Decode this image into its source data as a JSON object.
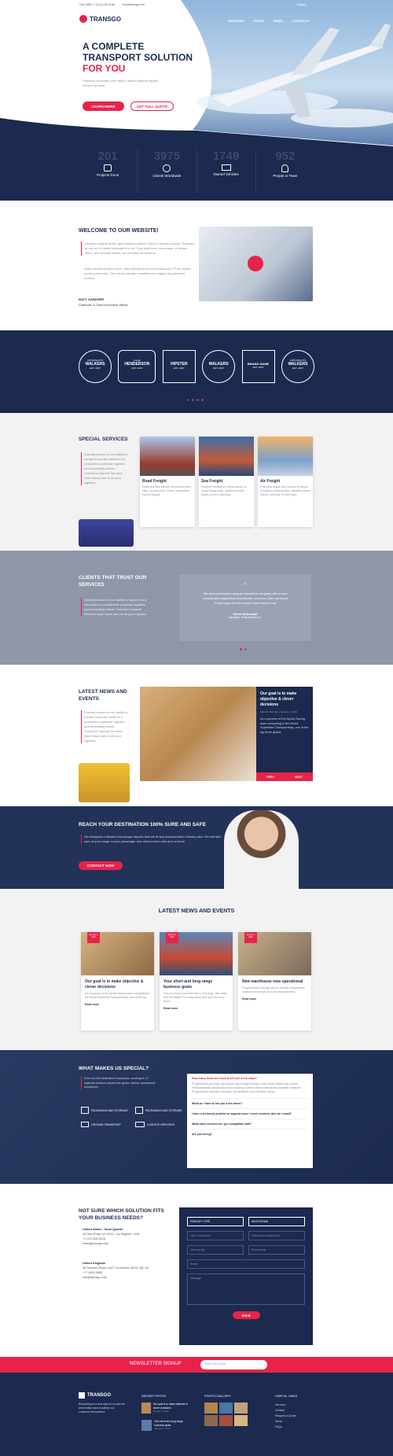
{
  "topbar": {
    "phone": "Call 1988 • 1 (212) 234 4138",
    "email": "info@transgo.com",
    "language": "English"
  },
  "brand": {
    "name": "TRANSGO"
  },
  "nav": [
    "SERVICES",
    "PAGES",
    "NEWS",
    "CONTACTS"
  ],
  "hero": {
    "line1": "A COMPLETE",
    "line2": "TRANSPORT SOLUTION",
    "line3": "FOR YOU",
    "text": "Praesent venenatis velit neque, aliquet semper sapien semper sit amet.",
    "btn_more": "LEARN MORE",
    "btn_quote": "GET FULL QUOTE"
  },
  "stats": [
    {
      "num": "201",
      "label": "Projects Done"
    },
    {
      "num": "3975",
      "label": "Clients Worldwide"
    },
    {
      "num": "1749",
      "label": "Owned Vehicles"
    },
    {
      "num": "952",
      "label": "People in Team"
    }
  ],
  "welcome": {
    "title": "WELCOME TO OUR WEBSITE!",
    "p1": "Aenean volutpat tortor eget euismod laoreet. Nunc in faucibus ipsum. Praesent at orci ac mi mattis vehicula et ut mi. Cras eget nunc accumsan, ut dictum libero, per conubia nostra, per inceptos himenaeos.",
    "p2": "Etiam lobortis tempor dolor, vitae bibendum lorem faucibus sed. Proin lacinia purus porta tortor. Orci varius natoque penatibus et magnis dis parturient montes.",
    "name": "MATT GARDNER",
    "role": "Chairman & Chief Executive Officer"
  },
  "logos": [
    {
      "top": "ASTRONAUTS",
      "main": "WALKERS",
      "sub": "EST. 2007"
    },
    {
      "top": "Joseph",
      "main": "HENDERSON",
      "sub": "EST. 2007"
    },
    {
      "top": "",
      "main": "HIPSTER",
      "sub": "EST. 2007"
    },
    {
      "top": "",
      "main": "WALKERS",
      "sub": "EST. 2007"
    },
    {
      "top": "",
      "main": "BRAND NAME",
      "sub": "EST. 2007"
    },
    {
      "top": "ASTRONAUTS",
      "main": "WALKERS",
      "sub": "EST. 2007"
    }
  ],
  "services": {
    "title": "SPECIAL SERVICES",
    "text": "Globally known for our ability to handle every last detail of our customers' particular logistics and forwarding needs, TransGo's Special Services team takes care of all your logistics.",
    "items": [
      {
        "title": "Road Freight",
        "text": "Morbi sed odio blandit, elementum dolor vitae, cursus turpis. Donec consectetur viverra feugiat."
      },
      {
        "title": "Sea Freight",
        "text": "Vivamus vestibulum luctus mauris, id ornare ligula nulla. Vestibulum ante ipsum primis in faucibus."
      },
      {
        "title": "Air Freight",
        "text": "Phasellus augue elit, rhoncus et dictum a, eleifend placerat diam. Aliquam massa mauris, vehicula vel felis eget."
      }
    ]
  },
  "clients": {
    "title": "CLIENTS THAT TRUST OUR SERVICES",
    "text": "Globally known for our ability to handle every last detail of a customers' particular logistics and forwarding needs, TransGo's Special Services team takes care of all your logistics.",
    "quote": "We were previously using an unreliable company with a very complicated registration and transfer process. Then we found TransCargo and the control came back to us.",
    "person": "Steve McDonald",
    "company": "Manager, Tesla Motors Inc."
  },
  "news": {
    "title": "LATEST NEWS AND EVENTS",
    "text": "Globally known for our ability to handle every last detail of a customers' particular logistics and forwarding needs, TransGo's Special Services team takes care of all your logistics.",
    "post_title": "Our goal is to make objective & clever decisions",
    "post_meta": "Malcolm Balmain • January 3, 2016",
    "post_text": "As a sponsor of the Apollo Racing team competing in the World Superbike Championship, one of the top three global.",
    "prev": "PREV",
    "next": "NEXT"
  },
  "cta": {
    "title": "REACH YOUR DESTINATION 100% SURE AND SAFE",
    "text": "We designed a detailed homepage layouts that will fit any transportation industry also. We will take care of your cargo or your passenger and deliver them safe and on time!",
    "btn": "CONTACT NOW"
  },
  "news2": {
    "title": "LATEST NEWS AND EVENTS",
    "read": "Read more",
    "items": [
      {
        "date": "January 3, 2016",
        "title": "Our goal is to make objective & clever decisions",
        "text": "As a sponsor of the Apollo Racing team competing in the World Superbike Championship, one of the top."
      },
      {
        "date": "January 3, 2016",
        "title": "Your short and long range business goals",
        "text": "How to move a machine that is 20m long, 18m wide and 4m height? It is easy when you have the best team."
      },
      {
        "date": "January 3, 2016",
        "title": "New warehouse now operational",
        "text": "Progressively leverage other's domain-independent business wholesale vis-a-vis empowerment."
      }
    ]
  },
  "special": {
    "title": "WHAT MAKES US SPECIAL?",
    "text": "Over 40,000 dedicated employees, working in 17 regional clusters around the globe, deliver operational excellence.",
    "features": [
      "PACKAGING AND STORAGE",
      "PACKAGING AND STORAGE",
      "GROUND TRANSPORT",
      "LOGISTIC SERVICES"
    ],
    "faq": [
      {
        "q": "How many times do I have to tell you a few ways?",
        "a": "Progressively generate synergistic total linkage through cross-media intellectual capital. Enthusiastically parallel task team building e-tailers without standards compliant initiatives. Progressively maintain extensive infomediaries via extensible niches."
      },
      {
        "q": "What do I have to tell you a few times?"
      },
      {
        "q": "I have a technical problem or support issue I need resolved, who do I email?"
      },
      {
        "q": "What other services are you compatible with?"
      },
      {
        "q": "Are you hiring?"
      }
    ]
  },
  "contact": {
    "title": "NOT SURE WHICH SOLUTION FITS YOUR BUSINESS NEEDS?",
    "offices": [
      {
        "name": "United States - Head Quarter",
        "address": "16 New Road, NY 4411, Los Angeles, USA",
        "phone": "+1 212 226-3126",
        "email": "head@transgo.com"
      },
      {
        "name": "United Kingdom",
        "address": "30 Dunham Road, LA27 Ka Market, M031 QB, UK",
        "phone": "+77 8923 3582",
        "email": "info@transgo.com"
      }
    ],
    "form": {
      "freight": "FREIGHT TYPE",
      "incoterms": "INCOTERMS",
      "departure": "City of departure",
      "weight": "Total gross weight (KG)",
      "delivery": "Delivery city",
      "dimensions": "Dimensions",
      "email": "Email",
      "message": "Message",
      "send": "Send"
    }
  },
  "newsletter": {
    "title": "NEWSLETTER SIGNUP",
    "placeholder": "Enter Your Email"
  },
  "footer": {
    "about": "Everything is a new day for us and we work really hard to satisfy our customer everywhere.",
    "recent_title": "RECENT POSTS",
    "recent": [
      {
        "title": "Our goal is to make objective & clever decisions",
        "date": "January 3, 2016"
      },
      {
        "title": "Your short and long range business goals",
        "date": "January 3, 2016"
      }
    ],
    "gallery_title": "PHOTO GALLERY",
    "links_title": "USEFUL LINKS",
    "links": [
      "Services",
      "Contact",
      "Request A Quote",
      "News",
      "FAQs"
    ]
  },
  "colors": {
    "navy": "#1b2a4e",
    "red": "#e8234a",
    "grey": "#8f96a8"
  }
}
